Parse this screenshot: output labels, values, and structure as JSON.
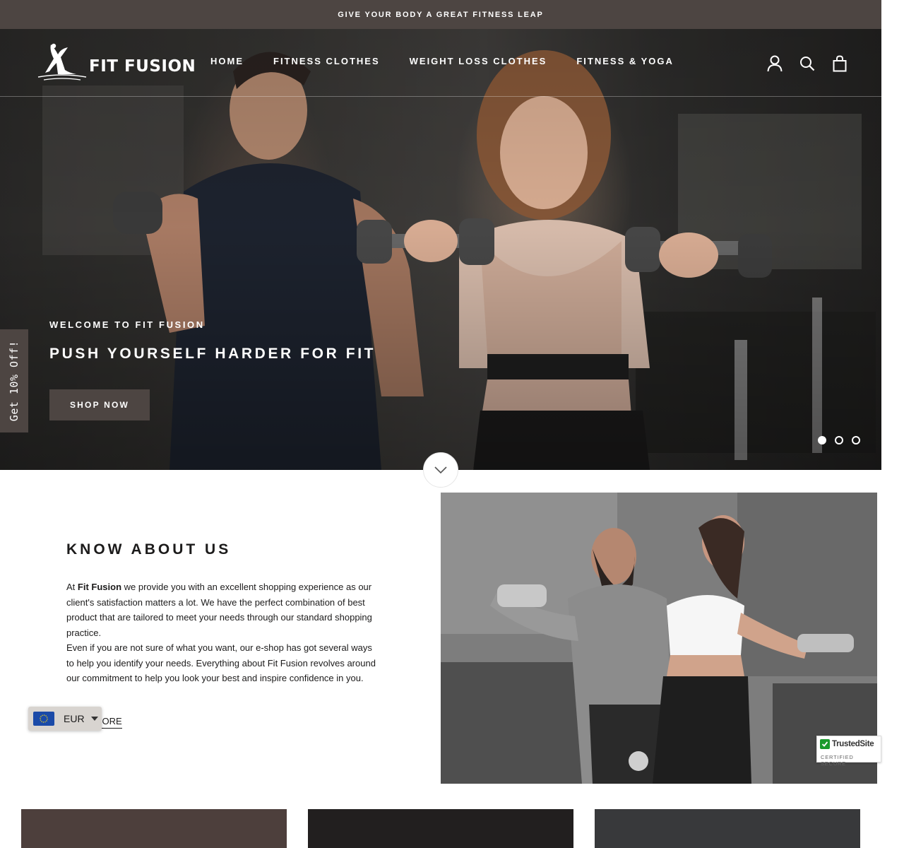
{
  "announcement": "GIVE YOUR BODY A GREAT FITNESS LEAP",
  "brand": {
    "name": "FIT FUSION"
  },
  "nav": {
    "items": [
      {
        "label": "HOME"
      },
      {
        "label": "FITNESS CLOTHES"
      },
      {
        "label": "WEIGHT LOSS CLOTHES"
      },
      {
        "label": "FITNESS & YOGA"
      }
    ]
  },
  "header_icons": [
    "account-icon",
    "search-icon",
    "cart-icon"
  ],
  "hero": {
    "subtitle": "WELCOME TO FIT FUSION",
    "title": "PUSH YOURSELF HARDER FOR FIT",
    "button_label": "SHOP NOW",
    "slides": 3,
    "active_slide": 1
  },
  "side_tab": "Get 10% Off!",
  "about": {
    "title": "KNOW ABOUT US",
    "brand_bold": "Fit Fusion",
    "p1_before": "At ",
    "p1_after": " we provide you with an excellent shopping experience as our client's satisfaction matters a lot. We have the perfect combination of best product that are tailored to meet your needs through our standard shopping practice.",
    "p2": "Even if you are not sure of what you want, our e-shop has got several ways to help you identify your needs. Everything about Fit Fusion revolves around our commitment to help you look your best and inspire confidence in you.",
    "read_more": "READ MORE"
  },
  "currency": {
    "code": "EUR"
  },
  "trusted_site": {
    "name": "TrustedSite",
    "sub": "CERTIFIED SECURE"
  },
  "colors": {
    "announcement_bg": "#4d4542",
    "button_bg": "#4d4542",
    "text": "#1c1b1b",
    "card_1": "#4d3f3c",
    "card_2": "#221f1f",
    "card_3": "#38393b"
  }
}
